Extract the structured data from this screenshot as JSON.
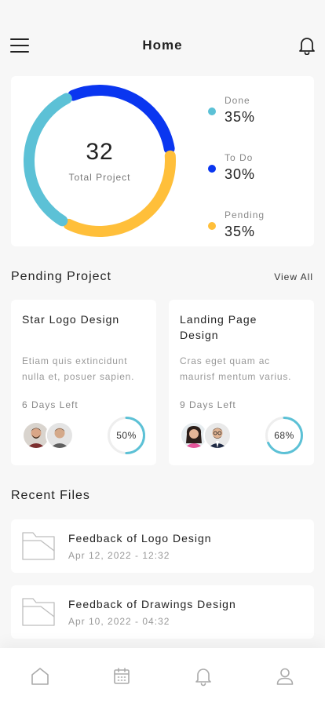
{
  "header": {
    "title": "Home"
  },
  "summary": {
    "total": "32",
    "total_label": "Total Project",
    "legend": [
      {
        "name": "Done",
        "value": "35%",
        "color": "#5cc1d6"
      },
      {
        "name": "To Do",
        "value": "30%",
        "color": "#0a36f0"
      },
      {
        "name": "Pending",
        "value": "35%",
        "color": "#ffbf3a"
      }
    ]
  },
  "chart_data": {
    "type": "pie",
    "categories": [
      "Done",
      "To Do",
      "Pending"
    ],
    "values": [
      35,
      30,
      35
    ],
    "colors": [
      "#5cc1d6",
      "#0a36f0",
      "#ffbf3a"
    ]
  },
  "pending": {
    "title": "Pending Project",
    "view_all": "View All",
    "projects": [
      {
        "title": "Star Logo Design",
        "desc": "Etiam quis extincidunt nulla et, posuer sapien.",
        "days": "6 Days Left",
        "progress": 50,
        "progress_label": "50%"
      },
      {
        "title": "Landing Page Design",
        "desc": "Cras eget quam ac maurisf mentum varius.",
        "days": "9 Days Left",
        "progress": 68,
        "progress_label": "68%"
      }
    ]
  },
  "recent": {
    "title": "Recent Files",
    "files": [
      {
        "name": "Feedback of Logo Design",
        "date": "Apr 12, 2022 - 12:32"
      },
      {
        "name": "Feedback of Drawings Design",
        "date": "Apr 10, 2022 - 04:32"
      }
    ]
  },
  "nav": {
    "items": [
      {
        "icon": "home-icon"
      },
      {
        "icon": "calendar-icon"
      },
      {
        "icon": "bell-icon"
      },
      {
        "icon": "profile-icon"
      }
    ]
  },
  "colors": {
    "accent": "#5cc1d6",
    "ring_track": "#eeeeee"
  }
}
